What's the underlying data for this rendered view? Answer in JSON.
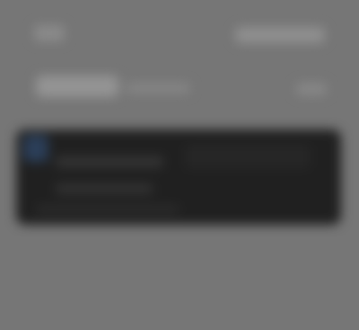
{
  "screen": {
    "background_color": "#767676",
    "panel_color": "#202020",
    "accent_color": "#2b3e58"
  },
  "header": {
    "left_label": "",
    "right_label": ""
  },
  "content": {
    "title": "",
    "subtitle": "",
    "meta": ""
  },
  "card": {
    "icon": "user-avatar-icon",
    "line_1": "",
    "line_2": "",
    "line_3": "",
    "right_text": ""
  }
}
